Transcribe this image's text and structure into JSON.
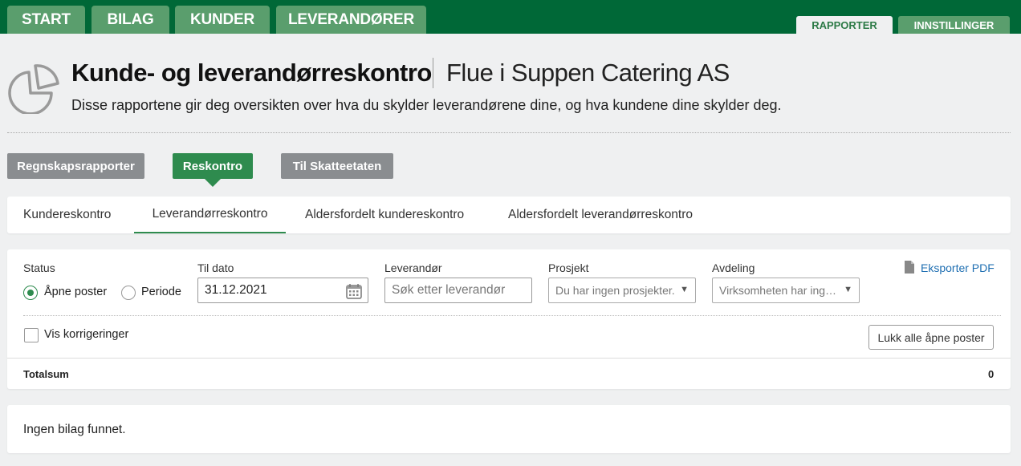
{
  "top_nav": {
    "main_tabs": [
      "START",
      "BILAG",
      "KUNDER",
      "LEVERANDØRER"
    ],
    "side_tabs": [
      "RAPPORTER",
      "INNSTILLINGER"
    ],
    "active_side_tab": "RAPPORTER"
  },
  "header": {
    "icon": "pie-chart-icon",
    "title": "Kunde- og leverandørreskontro",
    "company": "Flue i Suppen Catering AS",
    "subtitle": "Disse rapportene gir deg oversikten over hva du skylder leverandørene dine, og hva kundene dine skylder deg."
  },
  "report_types": {
    "items": [
      "Regnskapsrapporter",
      "Reskontro",
      "Til Skatteetaten"
    ],
    "active": "Reskontro"
  },
  "subtabs": {
    "items": [
      "Kundereskontro",
      "Leverandørreskontro",
      "Aldersfordelt kundereskontro",
      "Aldersfordelt leverandørreskontro"
    ],
    "active": "Leverandørreskontro"
  },
  "filters": {
    "status_label": "Status",
    "status_options": [
      "Åpne poster",
      "Periode"
    ],
    "status_selected": "Åpne poster",
    "date_label": "Til dato",
    "date_value": "31.12.2021",
    "supplier_label": "Leverandør",
    "supplier_placeholder": "Søk etter leverandør",
    "project_label": "Prosjekt",
    "project_value": "Du har ingen prosjekter.",
    "department_label": "Avdeling",
    "department_value": "Virksomheten har ingen avdelinger.",
    "export_label": "Eksporter PDF",
    "show_corrections_label": "Vis korrigeringer",
    "show_corrections_checked": false,
    "close_all_label": "Lukk alle åpne poster"
  },
  "totals": {
    "label": "Totalsum",
    "value": "0"
  },
  "results": {
    "empty_message": "Ingen bilag funnet."
  },
  "colors": {
    "brand_dark": "#006837",
    "tab_green": "#5a9e6d",
    "accent": "#2e8b4e",
    "link": "#1f6fb2",
    "button_gray": "#8a8d90"
  }
}
